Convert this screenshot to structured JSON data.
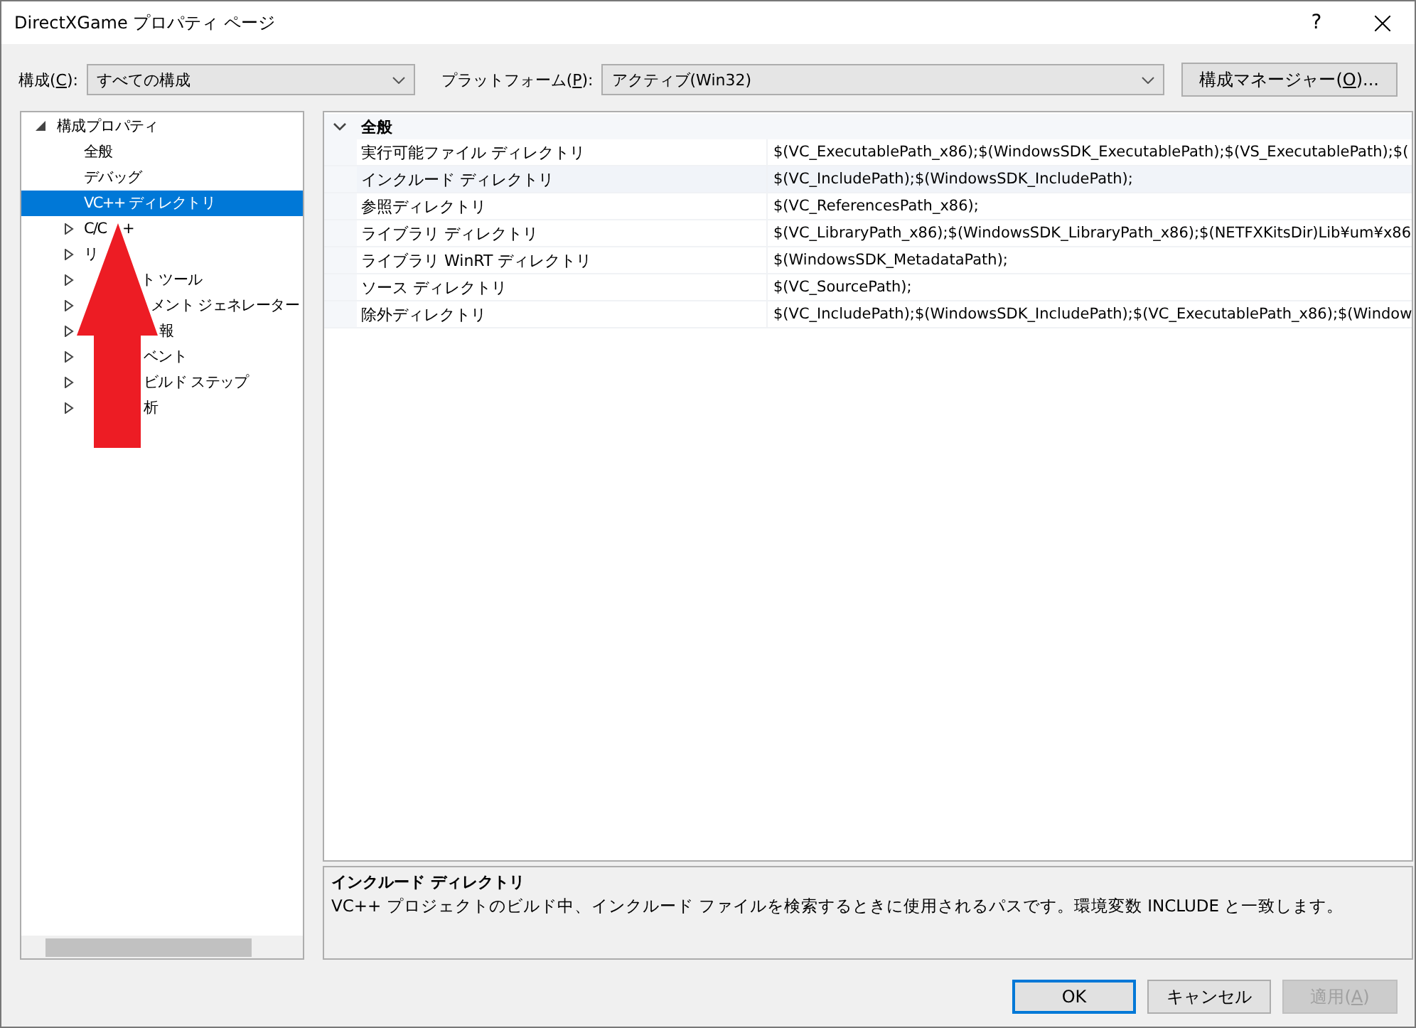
{
  "window": {
    "title": "DirectXGame プロパティ ページ",
    "help": "?"
  },
  "toolbar": {
    "configuration": {
      "label_start": "構成(",
      "mnemonic": "C",
      "label_end": "):",
      "value": "すべての構成"
    },
    "platform": {
      "label_start": "プラットフォーム(",
      "mnemonic": "P",
      "label_end": "):",
      "value": "アクティブ(Win32)"
    },
    "manager_button": {
      "label_start": "構成マネージャー(",
      "mnemonic": "O",
      "label_end": ")..."
    }
  },
  "tree": {
    "items": [
      {
        "kind": "folder",
        "parts": [
          {
            "text": "構成プロパティ"
          }
        ],
        "selected": false,
        "expanded": true,
        "children": [
          {
            "kind": "leaf",
            "parts": [
              {
                "text": "全般"
              }
            ],
            "selected": false
          },
          {
            "kind": "leaf",
            "parts": [
              {
                "text": "デバッグ"
              }
            ],
            "selected": false
          },
          {
            "kind": "leaf",
            "parts": [
              {
                "text": "VC++ ディレクトリ"
              }
            ],
            "selected": true
          },
          {
            "kind": "folder",
            "parts": [
              {
                "text": "C/C"
              },
              {
                "text": "+",
                "after_arrow": true
              }
            ],
            "selected": false,
            "expanded": false
          },
          {
            "kind": "folder",
            "parts": [
              {
                "text": "リ"
              }
            ],
            "selected": false,
            "expanded": false
          },
          {
            "kind": "folder",
            "parts": [
              {
                "text": "ト ツール",
                "after_arrow": true
              }
            ],
            "selected": false,
            "expanded": false
          },
          {
            "kind": "folder",
            "parts": [
              {
                "text": "メント ジェネレーター",
                "after_arrow": true
              }
            ],
            "selected": false,
            "expanded": false
          },
          {
            "kind": "folder",
            "parts": [
              {
                "text": "報",
                "after_arrow": true
              }
            ],
            "selected": false,
            "expanded": false
          },
          {
            "kind": "folder",
            "parts": [
              {
                "text": "ベント",
                "after_arrow": true
              }
            ],
            "selected": false,
            "expanded": false
          },
          {
            "kind": "folder",
            "parts": [
              {
                "text": "ビルド ステップ",
                "after_arrow": true
              }
            ],
            "selected": false,
            "expanded": false
          },
          {
            "kind": "folder",
            "parts": [
              {
                "text": "析",
                "after_arrow": true
              }
            ],
            "selected": false,
            "expanded": false
          }
        ]
      }
    ]
  },
  "grid": {
    "category": {
      "label": "全般",
      "expanded": true
    },
    "rows": [
      {
        "name": "実行可能ファイル ディレクトリ",
        "value": "$(VC_ExecutablePath_x86);$(WindowsSDK_ExecutablePath);$(VS_ExecutablePath);$(",
        "selected": false
      },
      {
        "name": "インクルード ディレクトリ",
        "value": "$(VC_IncludePath);$(WindowsSDK_IncludePath);",
        "selected": true
      },
      {
        "name": "参照ディレクトリ",
        "value": "$(VC_ReferencesPath_x86);",
        "selected": false
      },
      {
        "name": "ライブラリ ディレクトリ",
        "value": "$(VC_LibraryPath_x86);$(WindowsSDK_LibraryPath_x86);$(NETFXKitsDir)Lib¥um¥x86",
        "selected": false
      },
      {
        "name": "ライブラリ WinRT ディレクトリ",
        "value": "$(WindowsSDK_MetadataPath);",
        "selected": false
      },
      {
        "name": "ソース ディレクトリ",
        "value": "$(VC_SourcePath);",
        "selected": false
      },
      {
        "name": "除外ディレクトリ",
        "value": "$(VC_IncludePath);$(WindowsSDK_IncludePath);$(VC_ExecutablePath_x86);$(Window",
        "selected": false
      }
    ]
  },
  "description": {
    "title": "インクルード ディレクトリ",
    "text": "VC++ プロジェクトのビルド中、インクルード ファイルを検索するときに使用されるパスです。環境変数 INCLUDE と一致します。"
  },
  "buttons": [
    {
      "label_start": "OK",
      "default": true,
      "disabled": false
    },
    {
      "label_start": "キャンセル",
      "default": false,
      "disabled": false
    },
    {
      "label_start": "適用(",
      "mnemonic": "A",
      "label_end": ")",
      "default": false,
      "disabled": true
    }
  ]
}
